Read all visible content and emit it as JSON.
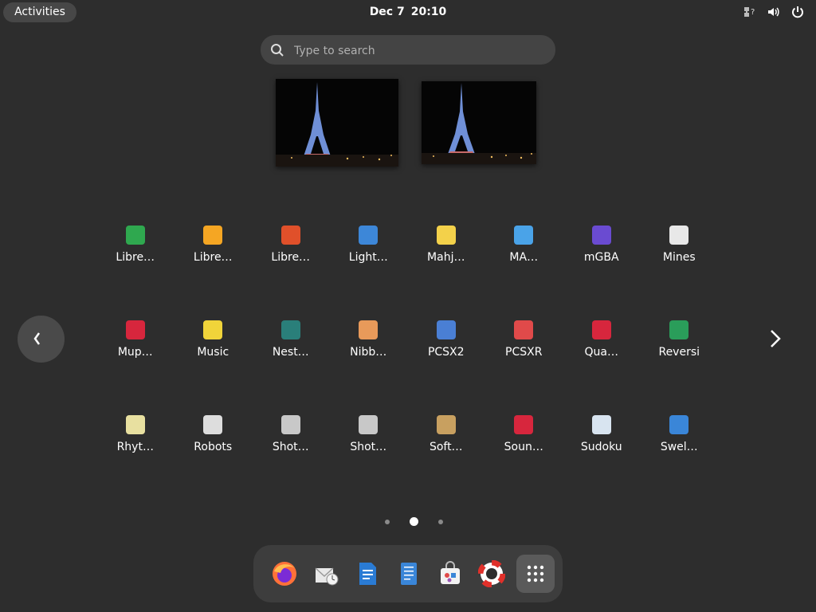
{
  "top_bar": {
    "activities_label": "Activities",
    "date": "Dec 7",
    "time": "20:10"
  },
  "search": {
    "placeholder": "Type to search"
  },
  "thumbnails": [
    {
      "name": "window-thumbnail-1"
    },
    {
      "name": "window-thumbnail-2"
    }
  ],
  "apps": [
    {
      "label": "Libre…",
      "icon": "libreoffice-calc-icon",
      "color": "#2fa84f"
    },
    {
      "label": "Libre…",
      "icon": "libreoffice-draw-icon",
      "color": "#f5a623"
    },
    {
      "label": "Libre…",
      "icon": "libreoffice-impress-icon",
      "color": "#e0502a"
    },
    {
      "label": "Light…",
      "icon": "lightsoff-icon",
      "color": "#3d87d8"
    },
    {
      "label": "Mahj…",
      "icon": "mahjongg-icon",
      "color": "#f3d14a"
    },
    {
      "label": "MA…",
      "icon": "mame-icon",
      "color": "#4aa3e8"
    },
    {
      "label": "mGBA",
      "icon": "mgba-icon",
      "color": "#6a4bd1"
    },
    {
      "label": "Mines",
      "icon": "mines-icon",
      "color": "#e8e8e8"
    },
    {
      "label": "Mup…",
      "icon": "mupen64-icon",
      "color": "#d7263d"
    },
    {
      "label": "Music",
      "icon": "music-icon",
      "color": "#f0d43a"
    },
    {
      "label": "Nest…",
      "icon": "nestopia-icon",
      "color": "#2a7f7a"
    },
    {
      "label": "Nibb…",
      "icon": "nibbles-icon",
      "color": "#e89a5a"
    },
    {
      "label": "PCSX2",
      "icon": "pcsx2-icon",
      "color": "#4a7fd4"
    },
    {
      "label": "PCSXR",
      "icon": "pcsxr-icon",
      "color": "#e04a4a"
    },
    {
      "label": "Qua…",
      "icon": "quadrapassel-icon",
      "color": "#d7263d"
    },
    {
      "label": "Reversi",
      "icon": "reversi-icon",
      "color": "#2a9d5a"
    },
    {
      "label": "Rhyt…",
      "icon": "rhythmbox-icon",
      "color": "#e8e0a0"
    },
    {
      "label": "Robots",
      "icon": "robots-icon",
      "color": "#dddddd"
    },
    {
      "label": "Shot…",
      "icon": "shotwell-icon",
      "color": "#c8c8c8"
    },
    {
      "label": "Shot…",
      "icon": "shotwell-viewer-icon",
      "color": "#c8c8c8"
    },
    {
      "label": "Soft…",
      "icon": "software-properties-icon",
      "color": "#c8a060"
    },
    {
      "label": "Soun…",
      "icon": "sound-recorder-icon",
      "color": "#d7263d"
    },
    {
      "label": "Sudoku",
      "icon": "sudoku-icon",
      "color": "#d8e4f0"
    },
    {
      "label": "Swel…",
      "icon": "swell-foop-icon",
      "color": "#3a86d8"
    }
  ],
  "pagination": {
    "pages": 3,
    "current": 2
  },
  "dash": [
    {
      "name": "firefox-icon"
    },
    {
      "name": "evolution-icon"
    },
    {
      "name": "libreoffice-writer-icon"
    },
    {
      "name": "text-editor-icon"
    },
    {
      "name": "software-icon"
    },
    {
      "name": "help-icon"
    },
    {
      "name": "show-apps-icon"
    }
  ]
}
